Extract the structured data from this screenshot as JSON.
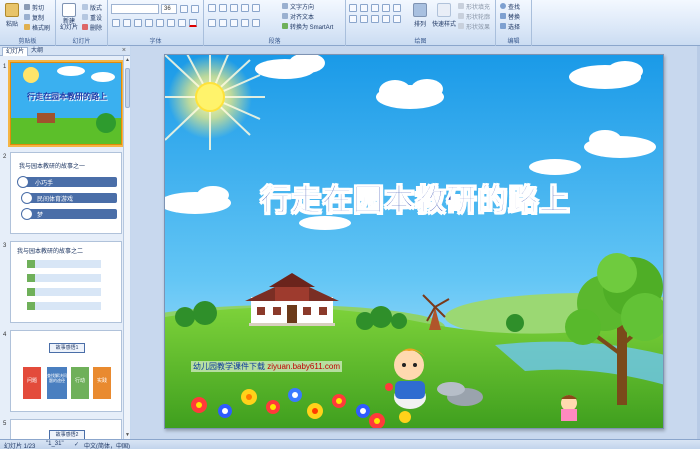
{
  "ribbon": {
    "clipboard": {
      "paste": "粘贴",
      "cut": "剪切",
      "copy": "复制",
      "format_painter": "格式刷",
      "label": "剪贴板"
    },
    "slides": {
      "new_slide": "新建\n幻灯片",
      "layout": "版式",
      "reset": "重设",
      "delete": "删除",
      "label": "幻灯片"
    },
    "font": {
      "font_name": "",
      "font_size": "36",
      "label": "字体"
    },
    "paragraph": {
      "text_direction": "文字方向",
      "align_text": "对齐文本",
      "smartart": "转换为 SmartArt",
      "label": "段落"
    },
    "drawing": {
      "arrange": "排列",
      "quick_styles": "快速样式",
      "shape_fill": "形状填充",
      "shape_outline": "形状轮廓",
      "shape_effects": "形状效果",
      "label": "绘图"
    },
    "editing": {
      "find": "查找",
      "replace": "替换",
      "select": "选择",
      "label": "编辑"
    }
  },
  "panel_tabs": {
    "slides": "幻灯片",
    "outline": "大纲",
    "close": "×"
  },
  "thumbnails": [
    {
      "num": "1",
      "title": "行走在园本教研的路上"
    },
    {
      "num": "2",
      "title": "我与园本教研的故事之一",
      "items": [
        "小巧手",
        "民间体育游戏",
        "梦"
      ]
    },
    {
      "num": "3",
      "title": "我与园本教研的故事之二",
      "items": [
        "",
        "",
        "",
        ""
      ]
    },
    {
      "num": "4",
      "title": "故事感悟1",
      "boxes": [
        "问题",
        "查找解决问题的途径",
        "行动",
        "实践"
      ]
    },
    {
      "num": "5",
      "title": "故事感悟2"
    }
  ],
  "slide": {
    "title": "行走在园本教研的路上",
    "watermark_text": "幼儿园教学课件下载 ",
    "watermark_url": "ziyuan.baby611.com"
  },
  "status": {
    "slide_info": "幻灯片 1/23",
    "theme": "\"1_31\"",
    "language": "中文(简体，中国)"
  },
  "colors": {
    "ribbon": "#dce8f8",
    "title_text": "#1e3aa8",
    "sky": "#3aaef0",
    "grass": "#5cbf2a"
  }
}
